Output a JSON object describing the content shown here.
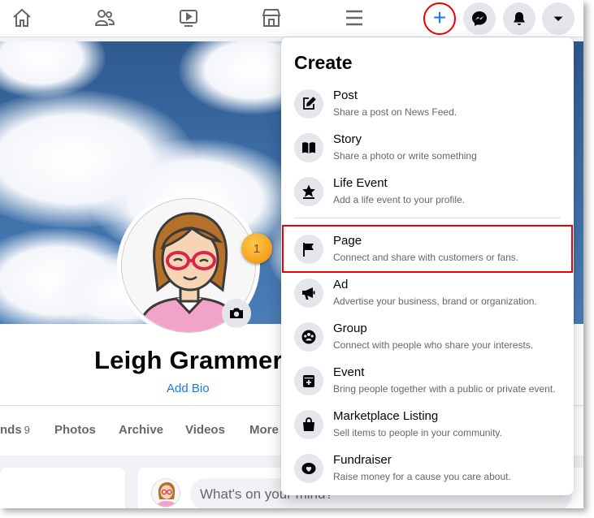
{
  "nav": {
    "icons": [
      "home-icon",
      "friends-icon",
      "watch-icon",
      "marketplace-icon",
      "menu-icon"
    ],
    "right_buttons": [
      "create-plus-icon",
      "messenger-icon",
      "notifications-bell-icon",
      "account-caret-icon"
    ],
    "plus_glyph": "+"
  },
  "profile": {
    "name": "Leigh Grammer",
    "add_bio": "Add Bio",
    "tabs": [
      {
        "label": "nds",
        "count": "9"
      },
      {
        "label": "Photos"
      },
      {
        "label": "Archive"
      },
      {
        "label": "Videos"
      },
      {
        "label": "More"
      }
    ],
    "post_placeholder": "What's on your mind?"
  },
  "step_badge": "1",
  "menu": {
    "title": "Create",
    "items": [
      {
        "label": "Post",
        "desc": "Share a post on News Feed.",
        "icon": "compose-icon"
      },
      {
        "label": "Story",
        "desc": "Share a photo or write something",
        "icon": "book-icon"
      },
      {
        "label": "Life Event",
        "desc": "Add a life event to your profile.",
        "icon": "star-icon"
      },
      {
        "label": "Page",
        "desc": "Connect and share with customers or fans.",
        "icon": "flag-icon"
      },
      {
        "label": "Ad",
        "desc": "Advertise your business, brand or organization.",
        "icon": "megaphone-icon"
      },
      {
        "label": "Group",
        "desc": "Connect with people who share your interests.",
        "icon": "group-icon"
      },
      {
        "label": "Event",
        "desc": "Bring people together with a public or private event.",
        "icon": "calendar-plus-icon"
      },
      {
        "label": "Marketplace Listing",
        "desc": "Sell items to people in your community.",
        "icon": "shopping-bag-icon"
      },
      {
        "label": "Fundraiser",
        "desc": "Raise money for a cause you care about.",
        "icon": "heart-coin-icon"
      }
    ]
  },
  "colors": {
    "accent": "#1877f2",
    "highlight": "#e00000",
    "badge": "#f5a623"
  }
}
